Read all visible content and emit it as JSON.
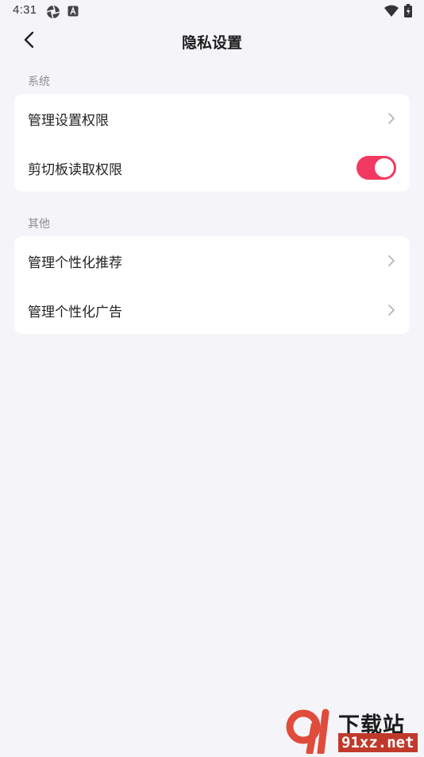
{
  "status_bar": {
    "time": "4:31",
    "icons": [
      "aperture-icon",
      "a-badge-icon",
      "wifi-icon",
      "battery-charging-icon"
    ]
  },
  "header": {
    "title": "隐私设置",
    "back_icon": "chevron-left-icon"
  },
  "sections": [
    {
      "label": "系统",
      "items": [
        {
          "label": "管理设置权限",
          "control": "chevron"
        },
        {
          "label": "剪切板读取权限",
          "control": "toggle",
          "enabled": true
        }
      ]
    },
    {
      "label": "其他",
      "items": [
        {
          "label": "管理个性化推荐",
          "control": "chevron"
        },
        {
          "label": "管理个性化广告",
          "control": "chevron"
        }
      ]
    }
  ],
  "watermark": {
    "logo_text": "91",
    "top_text": "下载站",
    "bottom_text": "91xz.net"
  },
  "colors": {
    "background": "#f5f5f9",
    "card": "#ffffff",
    "accent": "#f23a60",
    "section_label": "#8c8c91",
    "chevron": "#b5b5ba"
  }
}
